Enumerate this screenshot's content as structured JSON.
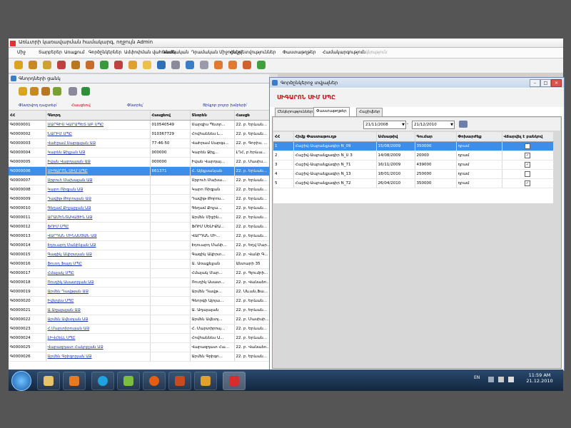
{
  "window": {
    "title": "Առևտրի կառավարման համակարգ, ողջույն Admin"
  },
  "menu": [
    {
      "label": "Միջ",
      "disabled": false
    },
    {
      "label": "Տարբերեր",
      "disabled": false
    },
    {
      "label": "Առաքում",
      "disabled": false
    },
    {
      "label": "Գործընկերներ",
      "disabled": false
    },
    {
      "label": "Ամփոփման վահանակ",
      "disabled": false
    },
    {
      "label": "Դաժեական",
      "disabled": false
    },
    {
      "label": "Դրամական Միջոցներ",
      "disabled": false
    },
    {
      "label": "Հաշվետվություններ",
      "disabled": false
    },
    {
      "label": "Փաստաթղթեր",
      "disabled": false
    },
    {
      "label": "Համակարգություն",
      "disabled": false
    },
    {
      "label": "Օգնություն",
      "disabled": true
    }
  ],
  "toolbar_icons": [
    "folder-icon",
    "folder-icon",
    "folder-icon",
    "folder-icon",
    "folder-icon",
    "folder-icon",
    "users-icon",
    "chart-icon",
    "calendar-icon",
    "image-icon",
    "chart-icon",
    "settings-icon",
    "globe-icon",
    "db-icon",
    "truck-icon",
    "truck-icon",
    "truck-icon",
    "truck-icon"
  ],
  "left_panel": {
    "title": "Գնորդների ցանկ",
    "filters": {
      "f1": "Փնտրվող դաշտեր՝",
      "f2": "Հասցեով",
      "f3": "Փնտրել՝",
      "f4": "Հասցեով",
      "f5": "Ցիկլոր բոլոր խմբերի՝"
    },
    "columns": [
      "ՀՀ",
      "Գնորդ",
      "Հասցեով",
      "Տնօրեն",
      "Հասցե"
    ],
    "selected_index": 5,
    "rows": [
      {
        "id": "Գ0000001",
        "name": "ՍԱՐԳԻՍ ԿԱՐԱՊԵՏ ԱԲ ՍՊԸ",
        "tax": "010540549",
        "dir": "Սարգիս Պետր...",
        "addr": "22. բ. Երևան..."
      },
      {
        "id": "Գ0000002",
        "name": "ՆԱՐԻՄ ՍՊԸ",
        "tax": "010367729",
        "dir": "Հովհաննես Լ...",
        "addr": "22. բ. Երևան..."
      },
      {
        "id": "Գ0000003",
        "name": "Վահրամ Սարգսյան ԱՁ",
        "tax": "77-46-50",
        "dir": "Վահրամ Սարգս...",
        "addr": "22. բ. Գորիս, ..."
      },
      {
        "id": "Գ0000004",
        "name": "Կարեն Ջիլլյան ԱՁ",
        "tax": "000000",
        "dir": "Կարեն Ջիլլ...",
        "addr": "ԼՂՀ, բ.Երևա..."
      },
      {
        "id": "Գ0000005",
        "name": "Իվան Վարդայան ԱՁ",
        "tax": "000000",
        "dir": "Իվան Վարդայ...",
        "addr": "22. բ. Մասիս..."
      },
      {
        "id": "Գ0000006",
        "name": "ՍԻԳԱՐՈՆ ՍԻՄ ՍՊԸ",
        "tax": "661371",
        "dir": "Հ. Ալեքսանյան",
        "addr": "22. բ. Երևան..."
      },
      {
        "id": "Գ0000007",
        "name": "Սրբուհ Մախայան ԱՁ",
        "tax": "",
        "dir": "Սրբուհ Մախա...",
        "addr": "22. բ. Երևան..."
      },
      {
        "id": "Գ0000008",
        "name": "Կարո Ռիզյան ԱՁ",
        "tax": "",
        "dir": "Կարո Ռիզյան",
        "addr": "22. բ. Երևան..."
      },
      {
        "id": "Գ0000009",
        "name": "Դավիթ Թորոսյան ԱՁ",
        "tax": "",
        "dir": "Դավիթ Թորոս...",
        "addr": "22. բ. Երևան..."
      },
      {
        "id": "Գ0000010",
        "name": "Գեղամ Քոչարյան ԱՁ",
        "tax": "",
        "dir": "Գեղամ Քոչա...",
        "addr": "22. բ. Երևան..."
      },
      {
        "id": "Գ0000011",
        "name": "ԱՐԱՄԵՆՏԱԿԱՅԻՆ ԱՁ",
        "tax": "",
        "dir": "Արմեն Միջին...",
        "addr": "22. բ. Երևան..."
      },
      {
        "id": "Գ0000012",
        "name": "ՖՈՒՄ ՍՊԸ",
        "tax": "",
        "dir": "ՖՈՒՄ ՍԵԼԻՔԱ...",
        "addr": "22. բ. Երևան..."
      },
      {
        "id": "Գ0000013",
        "name": "ՎԱՐԴԱՆ ՄԻՆԱՍՅԱՆ ԱՁ",
        "tax": "",
        "dir": "ՎԱՐԴԱՆ ՄԻ...",
        "addr": "22. բ. Երևան..."
      },
      {
        "id": "Գ0000014",
        "name": "Էդուարդ Մանինյան ԱՁ",
        "tax": "",
        "dir": "Էդուարդ Մանի...",
        "addr": "22. բ. Եղվ Մար..."
      },
      {
        "id": "Գ0000015",
        "name": "Գագիկ Ակիրտյան ԱՁ",
        "tax": "",
        "dir": "Գագիկ Ակիրտ...",
        "addr": "22. բ. Վանի Գ..."
      },
      {
        "id": "Գ0000016",
        "name": "Ֆուռդ Ֆայդ ՍՊԸ",
        "tax": "",
        "dir": "Ա. Առաքելյան",
        "addr": "Անտարի 35"
      },
      {
        "id": "Գ0000017",
        "name": "Հմայակ ՍՊԸ",
        "tax": "",
        "dir": "Հմայակ Մար...",
        "addr": "22. բ. Գյումրի..."
      },
      {
        "id": "Գ0000018",
        "name": "Ռուդիկ Ասատրյան ԱՁ",
        "tax": "",
        "dir": "Ռուդիկ Ասատ...",
        "addr": "22. բ. Վանաձո..."
      },
      {
        "id": "Գ0000019",
        "name": "Արմեն Դավթյան ԱՁ",
        "tax": "",
        "dir": "Արմեն Դավթ...",
        "addr": "22. Սևան,Ֆա..."
      },
      {
        "id": "Գ0000020",
        "name": "Իվերլես ՍՊԸ",
        "tax": "",
        "dir": "Գեորգի Ալոյա...",
        "addr": "22. բ. Երևան..."
      },
      {
        "id": "Գ0000021",
        "name": "Ա.Աղայայան ԱՁ",
        "tax": "",
        "dir": "Ա. Աղայայան",
        "addr": "22. բ. Երևան..."
      },
      {
        "id": "Գ0000022",
        "name": "Արմեն Ավետյան ԱՁ",
        "tax": "",
        "dir": "Արմեն Ավետյ...",
        "addr": "22. բ. Մասիսի..."
      },
      {
        "id": "Գ0000023",
        "name": "Հ.Մարտիրոսյան ԱՁ",
        "tax": "",
        "dir": "Հ. Մարտիրոսյ...",
        "addr": "22. բ. Երևան..."
      },
      {
        "id": "Գ0000024",
        "name": "ԼԻՎՀԵԼԼ ՍՊԸ",
        "tax": "",
        "dir": "Հովհաննես Ա...",
        "addr": "22. բ. Երևան..."
      },
      {
        "id": "Գ0000025",
        "name": "Վարազդատ Հակոբյան ԱՁ",
        "tax": "",
        "dir": "Վարազդատ Հա...",
        "addr": "22. բ. Վանաձո..."
      },
      {
        "id": "Գ0000026",
        "name": "Արմեն Գրիգորյան ԱՁ",
        "tax": "",
        "dir": "Արմեն Գրիգո...",
        "addr": "22. բ. Երևան..."
      }
    ]
  },
  "right_window": {
    "title": "Գործընկերոջ տվյալներ",
    "header": "ՍԻԳԱՐՈՆ ՍԻՄ ՍՊԸ",
    "tabs": [
      "Ընկերություններ",
      "Փաստաթղթեր",
      "Հաշիվներ"
    ],
    "active_tab": 1,
    "date_from": "21/11/2008",
    "date_to": "21/12/2010",
    "date_sep": "-",
    "columns": [
      "ՀՀ",
      "Հիմք Փաստաթուղթ",
      "Ամսաթիվ",
      "Գումար",
      "Փոխարժեք",
      "Վճարվել է բանկով"
    ],
    "selected_index": 0,
    "rows": [
      {
        "n": "1",
        "doc": "Հաշիվ-Ապրանքագիր N_09",
        "date": "15/08/2009",
        "sum": "350000",
        "cur": "դրամ",
        "paid": true
      },
      {
        "n": "2",
        "doc": "Հաշիվ-Ապրանքագիր N_Ս 3",
        "date": "14/08/2009",
        "sum": "20000",
        "cur": "դրամ",
        "paid": true
      },
      {
        "n": "3",
        "doc": "Հաշիվ-Ապրանքագիր N_71",
        "date": "16/11/2009",
        "sum": "439000",
        "cur": "դրամ",
        "paid": true
      },
      {
        "n": "4",
        "doc": "Հաշիվ-Ապրանքագիր N_13",
        "date": "18/01/2010",
        "sum": "250000",
        "cur": "դրամ",
        "paid": false
      },
      {
        "n": "5",
        "doc": "Հաշիվ-Ապրանքագիր N_72",
        "date": "26/04/2010",
        "sum": "350000",
        "cur": "դրամ",
        "paid": true
      }
    ]
  },
  "taskbar": {
    "lang": "EN",
    "time": "11:59 AM",
    "date": "21.12.2010"
  },
  "colors": {
    "selection": "#3d8ee8",
    "header_red": "#c01818",
    "link": "#1830b4"
  }
}
